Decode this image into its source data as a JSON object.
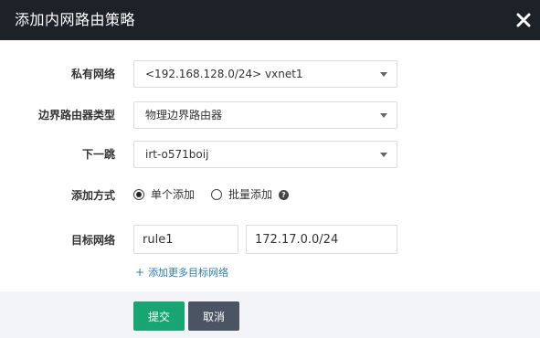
{
  "dialog": {
    "title": "添加内网路由策略",
    "close_icon": "close-icon"
  },
  "form": {
    "private_network": {
      "label": "私有网络",
      "value": "<192.168.128.0/24> vxnet1"
    },
    "border_router_type": {
      "label": "边界路由器类型",
      "value": "物理边界路由器"
    },
    "next_hop": {
      "label": "下一跳",
      "value": "irt-o571boij"
    },
    "add_mode": {
      "label": "添加方式",
      "options": [
        "单个添加",
        "批量添加"
      ],
      "selected": "单个添加",
      "help_icon": "question-circle-icon"
    },
    "target_network": {
      "label": "目标网络",
      "name_value": "rule1",
      "cidr_value": "172.17.0.0/24",
      "add_more_label": "添加更多目标网络"
    }
  },
  "footer": {
    "submit_label": "提交",
    "cancel_label": "取消",
    "submit_color": "#17a673",
    "cancel_color": "#4a5462"
  },
  "colors": {
    "titlebar": "#1d2128",
    "link": "#2c7db5",
    "footer_bg": "#f3f4f7"
  }
}
